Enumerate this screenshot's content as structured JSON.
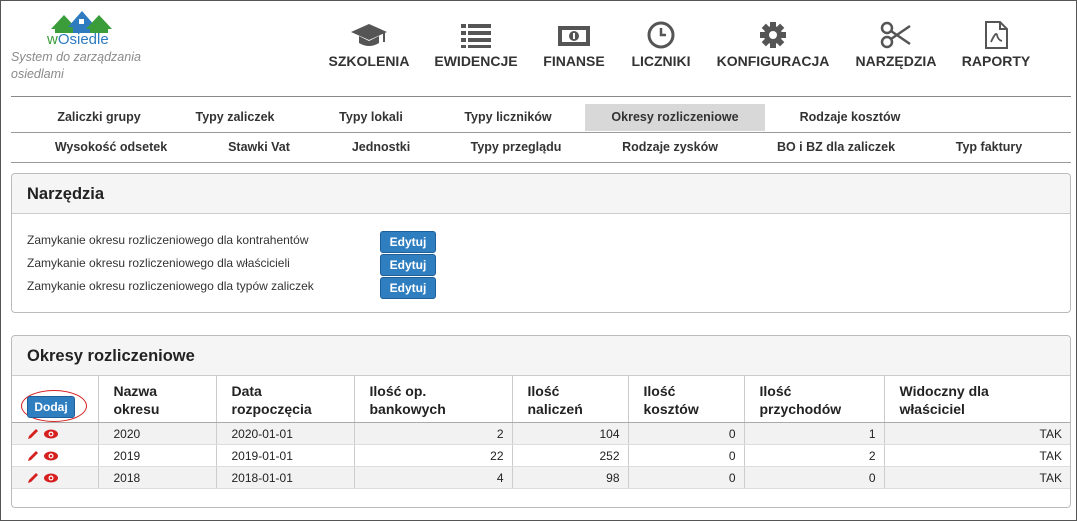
{
  "app": {
    "logo_text_w": "w",
    "logo_text_rest": "Osiedle",
    "tagline": "System do zarządzania osiedlami"
  },
  "nav": [
    {
      "label": "SZKOLENIA",
      "icon": "graduation-cap-icon"
    },
    {
      "label": "EWIDENCJE",
      "icon": "list-icon"
    },
    {
      "label": "FINANSE",
      "icon": "money-icon"
    },
    {
      "label": "LICZNIKI",
      "icon": "clock-icon"
    },
    {
      "label": "KONFIGURACJA",
      "icon": "gear-icon"
    },
    {
      "label": "NARZĘDZIA",
      "icon": "scissors-icon"
    },
    {
      "label": "RAPORTY",
      "icon": "pdf-file-icon"
    }
  ],
  "tabs_row1": [
    "Zaliczki grupy",
    "Typy zaliczek",
    "Typy lokali",
    "Typy liczników",
    "Okresy rozliczeniowe",
    "Rodzaje kosztów"
  ],
  "tabs_row2": [
    "Wysokość odsetek",
    "Stawki Vat",
    "Jednostki",
    "Typy przeglądu",
    "Rodzaje zysków",
    "BO i BZ dla zaliczek",
    "Typ faktury"
  ],
  "active_tab": "Okresy rozliczeniowe",
  "tools": {
    "title": "Narzędzia",
    "rows": [
      {
        "label": "Zamykanie okresu rozliczeniowego dla kontrahentów",
        "button": "Edytuj"
      },
      {
        "label": "Zamykanie okresu rozliczeniowego dla właścicieli",
        "button": "Edytuj"
      },
      {
        "label": "Zamykanie okresu rozliczeniowego dla typów zaliczek",
        "button": "Edytuj"
      }
    ]
  },
  "periods": {
    "title": "Okresy rozliczeniowe",
    "add_button": "Dodaj",
    "columns": [
      [
        "Nazwa",
        "okresu"
      ],
      [
        "Data",
        "rozpoczęcia"
      ],
      [
        "Ilość op.",
        "bankowych"
      ],
      [
        "Ilość",
        "naliczeń"
      ],
      [
        "Ilość",
        "kosztów"
      ],
      [
        "Ilość",
        "przychodów"
      ],
      [
        "Widoczny dla",
        "właściciel"
      ]
    ],
    "rows": [
      {
        "name": "2020",
        "start": "2020-01-01",
        "bank_ops": "2",
        "charges": "104",
        "costs": "0",
        "incomes": "1",
        "visible": "TAK"
      },
      {
        "name": "2019",
        "start": "2019-01-01",
        "bank_ops": "22",
        "charges": "252",
        "costs": "0",
        "incomes": "2",
        "visible": "TAK"
      },
      {
        "name": "2018",
        "start": "2018-01-01",
        "bank_ops": "4",
        "charges": "98",
        "costs": "0",
        "incomes": "0",
        "visible": "TAK"
      }
    ]
  },
  "colors": {
    "accent": "#2f7ec0",
    "highlight_ring": "#d62020",
    "action_icon": "#d62020"
  }
}
